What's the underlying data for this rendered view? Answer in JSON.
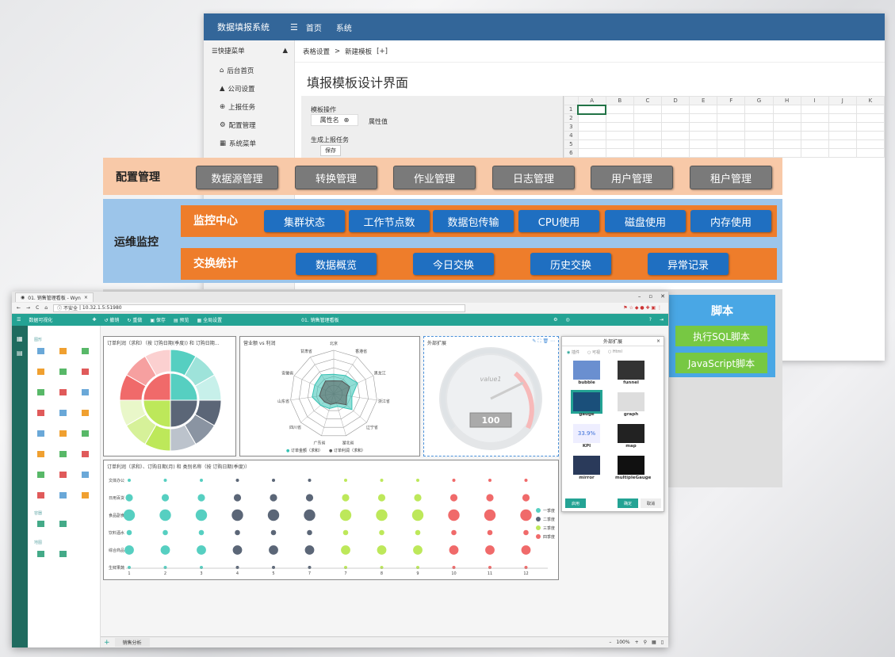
{
  "form_window": {
    "app_title": "数据填报系统",
    "nav": [
      "首页",
      "系统"
    ],
    "menu_header": "快捷菜单",
    "menu_items": [
      "后台首页",
      "公司设置",
      "上报任务",
      "配置管理",
      "系统菜单"
    ],
    "breadcrumb": [
      "表格设置",
      ">",
      "新建模板",
      "[+]"
    ],
    "page_title": "填报模板设计界面",
    "panel": {
      "section1": "模板操作",
      "prop_name": "属性名",
      "prop_value": "属性值",
      "section2": "生成上报任务",
      "save": "保存"
    },
    "grid": {
      "columns": [
        "A",
        "B",
        "C",
        "D",
        "E",
        "F",
        "G",
        "H",
        "I",
        "J",
        "K"
      ],
      "rows": [
        "1",
        "2",
        "3",
        "4",
        "5",
        "6"
      ],
      "active_cell": "A1"
    }
  },
  "config": {
    "title": "配置管理",
    "buttons": [
      "数据源管理",
      "转换管理",
      "作业管理",
      "日志管理",
      "用户管理",
      "租户管理"
    ]
  },
  "ops": {
    "title": "运维监控",
    "monitor": {
      "label": "监控中心",
      "buttons": [
        "集群状态",
        "工作节点数",
        "数据包传输",
        "CPU使用",
        "磁盘使用",
        "内存使用"
      ]
    },
    "exchange": {
      "label": "交换统计",
      "buttons": [
        "数据概览",
        "今日交换",
        "历史交换",
        "异常记录"
      ]
    }
  },
  "script": {
    "title": "脚本",
    "buttons": [
      "执行SQL脚本",
      "JavaScript脚本"
    ]
  },
  "browser": {
    "tab_title": "01. 销售管理看板 - Wyn",
    "insecure": "不安全",
    "url": "10.32.1.5:51980",
    "app_name": "数据可视化",
    "toolbar": [
      "撤销",
      "重做",
      "保存",
      "预览",
      "全局设置"
    ],
    "doc_title": "01. 销售管理看板",
    "pal_sections": [
      "图形",
      "容器",
      "地图"
    ],
    "pane1_title": "订单利润（求和）（按 订购日期(季度)) 和 订购日期...",
    "pane2_title": "营业额 vs 利润",
    "pane3_title": "外部扩展",
    "radar": {
      "labels": [
        "北京",
        "香港省",
        "黑龙江",
        "浙江省",
        "辽宁省",
        "湖北省",
        "广东省",
        "四川省",
        "山东省",
        "安徽省",
        "甘肃省"
      ],
      "legend": [
        "订单金额（求和）",
        "订单利润（求和）"
      ]
    },
    "gauge": {
      "value": "100",
      "label": "value1"
    },
    "ext_panel": {
      "title": "外部扩展",
      "radios": [
        "插件",
        "可视",
        "Html"
      ],
      "items": [
        "bubble",
        "funnel",
        "gauge",
        "graph",
        "KPI",
        "map",
        "mirror",
        "multipleGauge"
      ],
      "kpi_value": "33.9%",
      "buttons": [
        "启用",
        "确定",
        "取消"
      ]
    },
    "pane4_title": "订单利润（求和）、订购日期(月) 和 类别名称（按 订购日期(季度)）",
    "scatter": {
      "categories": [
        "文体办公",
        "日用百货",
        "食品副食",
        "饮料酒水",
        "综合商品",
        "生鲜果蔬"
      ],
      "months": [
        "1",
        "2",
        "3",
        "4",
        "5",
        "7",
        "7",
        "8",
        "9",
        "10",
        "11",
        "12"
      ],
      "legend": [
        "一季度",
        "二季度",
        "三季度",
        "四季度"
      ]
    },
    "sheet_tab": "销售分析",
    "zoom": "100%"
  },
  "colors": {
    "form_header": "#336699",
    "config_bg": "#f8c9a8",
    "ops_bg": "#9cc5ea",
    "orange": "#ee7d2b",
    "blue_btn": "#1f6fc1",
    "script_bg": "#49a7e5",
    "green_btn": "#77c843",
    "teal": "#24a394"
  }
}
